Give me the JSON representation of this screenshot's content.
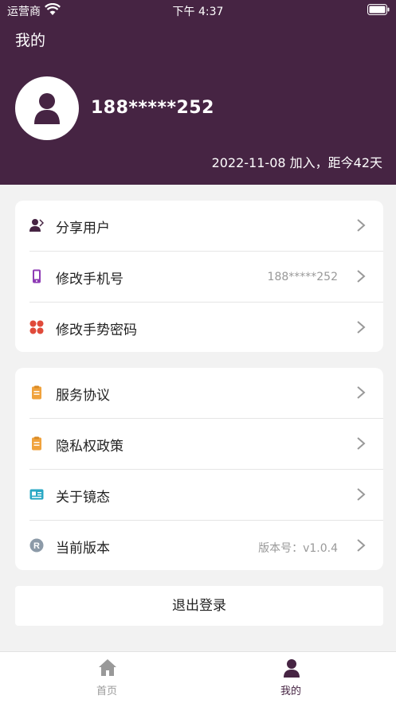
{
  "status_bar": {
    "carrier": "运营商",
    "time": "下午 4:37"
  },
  "header": {
    "title": "我的",
    "username": "188*****252",
    "join_info": "2022-11-08 加入，距今42天"
  },
  "menu_group_1": [
    {
      "label": "分享用户",
      "value": "",
      "icon": "share-user-icon"
    },
    {
      "label": "修改手机号",
      "value": "188*****252",
      "icon": "phone-icon"
    },
    {
      "label": "修改手势密码",
      "value": "",
      "icon": "gesture-password-icon"
    }
  ],
  "menu_group_2": [
    {
      "label": "服务协议",
      "value": "",
      "icon": "document-icon"
    },
    {
      "label": "隐私权政策",
      "value": "",
      "icon": "document-icon"
    },
    {
      "label": "关于镜态",
      "value": "",
      "icon": "info-card-icon"
    },
    {
      "label": "当前版本",
      "value": "版本号：v1.0.4",
      "icon": "version-icon"
    }
  ],
  "logout_label": "退出登录",
  "tabbar": {
    "tabs": [
      {
        "label": "首页",
        "icon": "home-icon",
        "active": false
      },
      {
        "label": "我的",
        "icon": "profile-icon",
        "active": true
      }
    ]
  },
  "colors": {
    "header_bg": "#462443",
    "active_tab": "#462443",
    "inactive_tab": "#999999",
    "share_icon": "#462443",
    "phone_icon": "#8e3bb5",
    "gesture_icon": "#e04a3a",
    "doc_icon": "#f0a23c",
    "info_icon": "#2aa8c4",
    "version_icon": "#8c9aa8"
  }
}
